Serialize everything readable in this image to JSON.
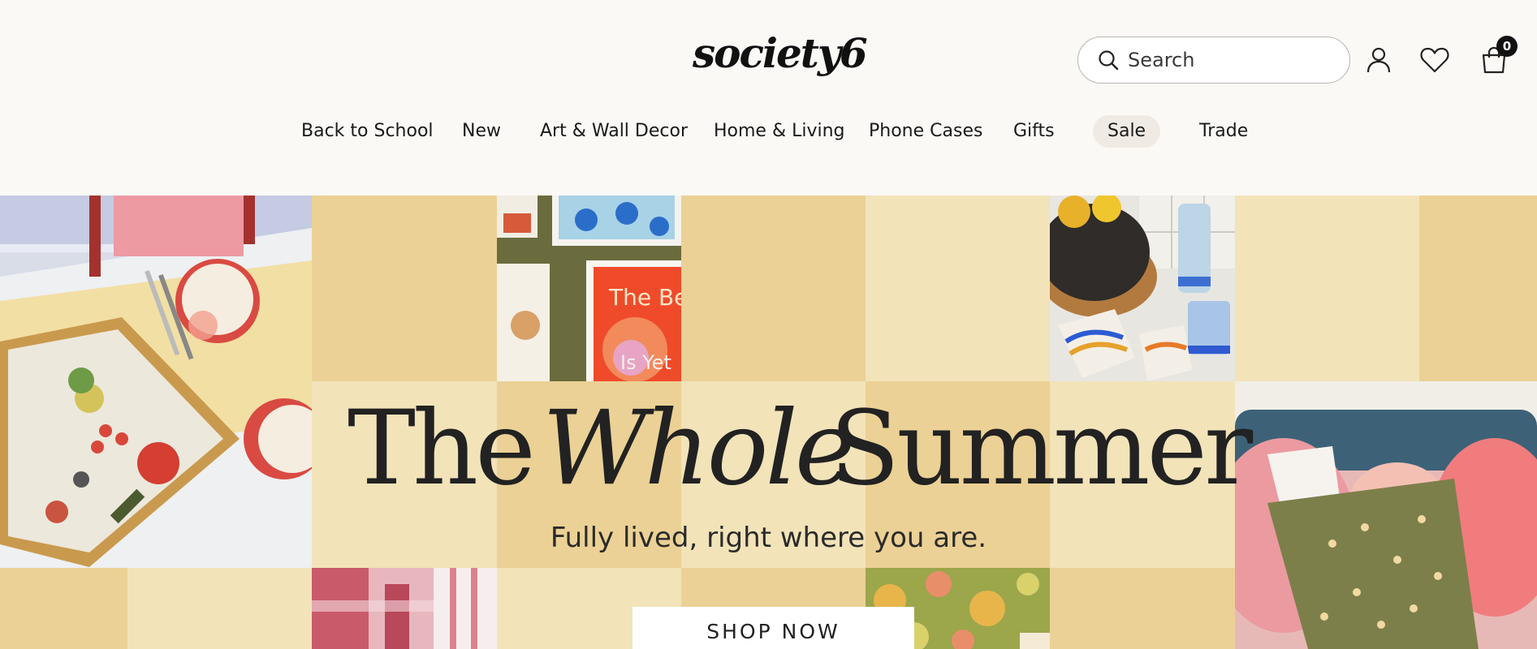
{
  "header": {
    "logo": "society6",
    "search": {
      "placeholder": "Search",
      "value": ""
    },
    "cart_count": "0",
    "icons": [
      "search-icon",
      "account-icon",
      "heart-icon",
      "cart-icon"
    ]
  },
  "nav": {
    "items": [
      {
        "label": "Back to School"
      },
      {
        "label": "New"
      },
      {
        "label": "Art & Wall Decor"
      },
      {
        "label": "Home & Living"
      },
      {
        "label": "Phone Cases"
      },
      {
        "label": "Gifts"
      },
      {
        "label": "Sale"
      },
      {
        "label": "Trade"
      }
    ]
  },
  "hero": {
    "headline_part1": "The",
    "headline_part2": "Whole",
    "headline_part3": "Summer",
    "subheadline": "Fully lived, right where you are.",
    "cta": "SHOP NOW",
    "poster_text_top": "The Bes",
    "poster_text_bottom": "Is Yet"
  },
  "colors": {
    "background": "#faf9f6",
    "banner_dark": "#ebd195",
    "banner_light": "#f2e3b9",
    "sale_pill": "#efebe4"
  }
}
